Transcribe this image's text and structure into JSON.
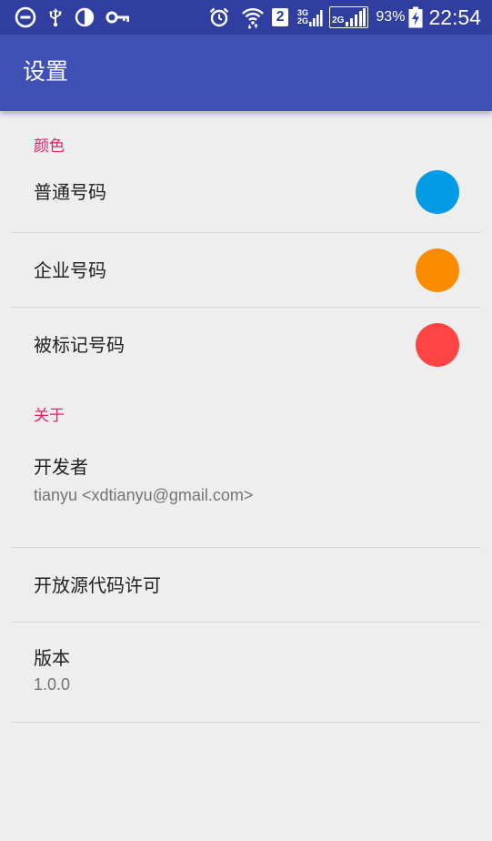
{
  "status_bar": {
    "battery_percent": "93%",
    "time": "22:54",
    "sim_slot": "2",
    "network_top": "3G",
    "network_bottom": "2G",
    "network_box_label": "2G",
    "icons": [
      "minus-circle-icon",
      "usb-icon",
      "brightness-icon",
      "key-icon",
      "alarm-icon",
      "wifi-icon",
      "signal-icon",
      "signal-icon",
      "battery-charging-icon"
    ]
  },
  "app_bar": {
    "title": "设置"
  },
  "sections": {
    "colors": {
      "header": "颜色",
      "items": [
        {
          "title": "普通号码",
          "color": "#039be5"
        },
        {
          "title": "企业号码",
          "color": "#fb8c00"
        },
        {
          "title": "被标记号码",
          "color": "#ff4444"
        }
      ]
    },
    "about": {
      "header": "关于",
      "developer": {
        "title": "开发者",
        "summary": "tianyu <xdtianyu@gmail.com>"
      },
      "licenses": {
        "title": "开放源代码许可"
      },
      "version": {
        "title": "版本",
        "summary": "1.0.0"
      }
    }
  }
}
